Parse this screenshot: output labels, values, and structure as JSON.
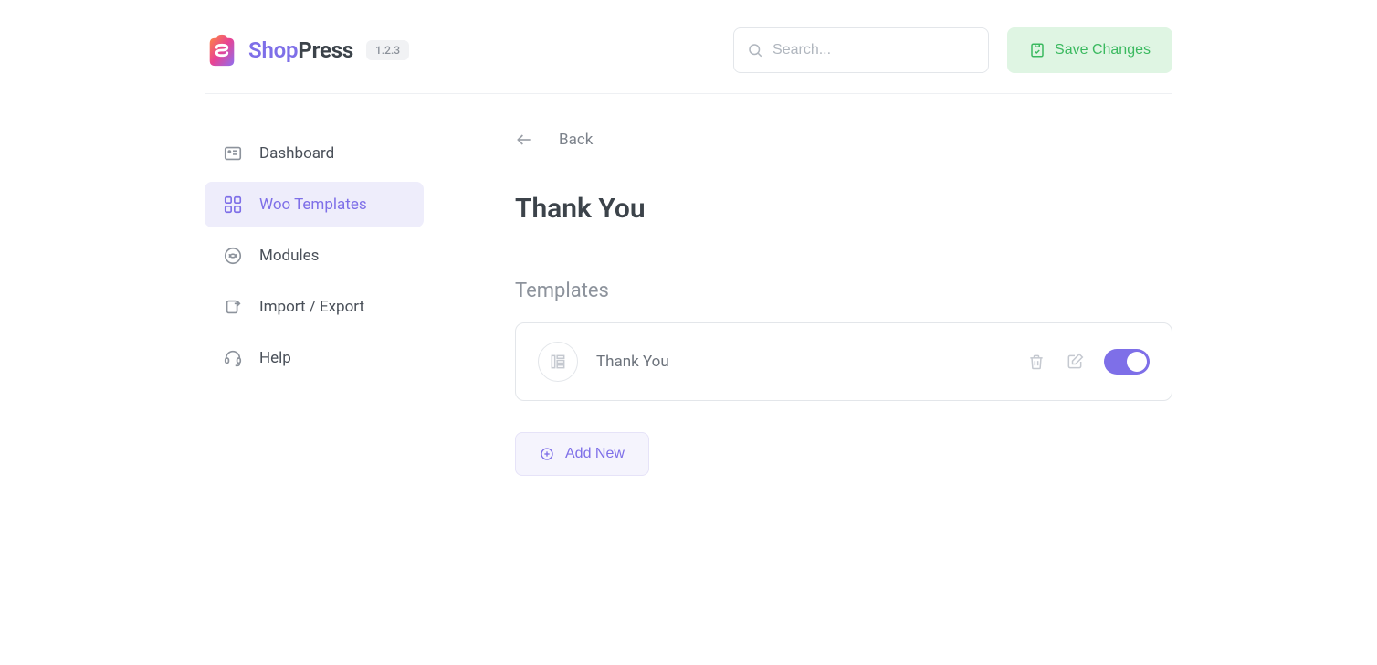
{
  "header": {
    "brand_shop": "Shop",
    "brand_press": "Press",
    "version": "1.2.3",
    "search_placeholder": "Search...",
    "save_label": "Save Changes"
  },
  "sidebar": {
    "items": [
      {
        "label": "Dashboard",
        "icon": "dashboard",
        "active": false
      },
      {
        "label": "Woo Templates",
        "icon": "templates",
        "active": true
      },
      {
        "label": "Modules",
        "icon": "modules",
        "active": false
      },
      {
        "label": "Import / Export",
        "icon": "import-export",
        "active": false
      },
      {
        "label": "Help",
        "icon": "help",
        "active": false
      }
    ]
  },
  "content": {
    "back_label": "Back",
    "page_title": "Thank You",
    "section_label": "Templates",
    "templates": [
      {
        "name": "Thank You",
        "enabled": true
      }
    ],
    "add_new_label": "Add New"
  }
}
